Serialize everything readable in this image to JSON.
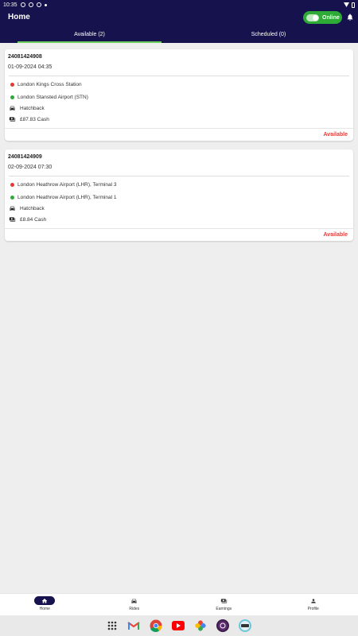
{
  "status_bar": {
    "time": "10:35"
  },
  "header": {
    "title": "Home",
    "online_label": "Online"
  },
  "tabs": [
    {
      "label": "Available (2)",
      "active": true
    },
    {
      "label": "Scheduled (0)",
      "active": false
    }
  ],
  "rides": [
    {
      "id": "24081424908",
      "datetime": "01-09-2024 04:35",
      "pickup": "London Kings Cross Station",
      "dropoff": "London Stansted Airport (STN)",
      "vehicle": "Hatchback",
      "fare": "£87.83 Cash",
      "status": "Available"
    },
    {
      "id": "24081424909",
      "datetime": "02-09-2024 07:30",
      "pickup": "London Heathrow Airport (LHR), Terminal 3",
      "dropoff": "London Heathrow Airport (LHR), Terminal 1",
      "vehicle": "Hatchback",
      "fare": "£8.84 Cash",
      "status": "Available"
    }
  ],
  "bottom_nav": [
    {
      "label": "Home",
      "icon": "home-icon",
      "active": true
    },
    {
      "label": "Rides",
      "icon": "car-icon",
      "active": false
    },
    {
      "label": "Earnings",
      "icon": "money-icon",
      "active": false
    },
    {
      "label": "Profile",
      "icon": "person-icon",
      "active": false
    }
  ],
  "colors": {
    "primary": "#15124e",
    "online": "#2eaa36",
    "pickup": "#e53935",
    "dropoff": "#2eaa36",
    "available": "#e53935"
  }
}
